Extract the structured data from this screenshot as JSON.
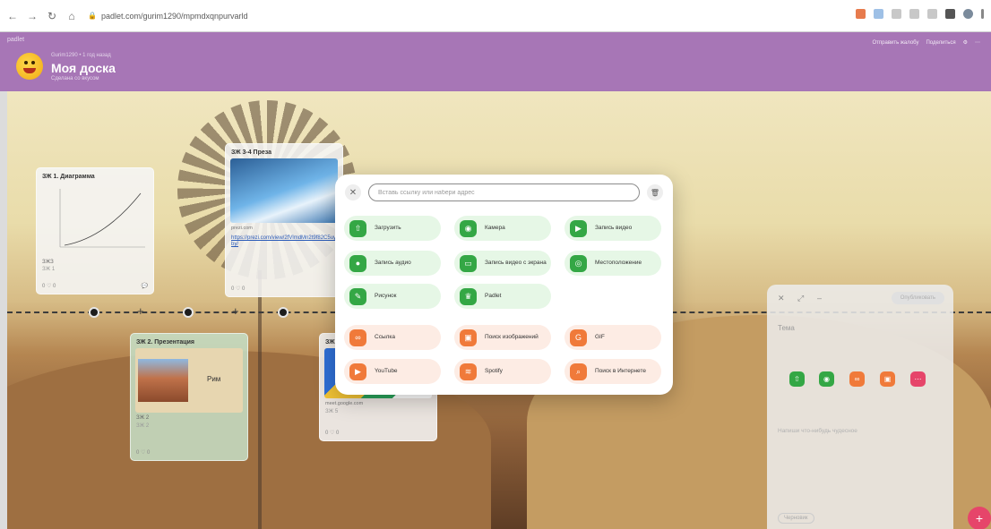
{
  "browser": {
    "url": "padlet.com/gurim1290/mpmdxqnpurvarld"
  },
  "header": {
    "logo": "padlet",
    "author": "Gurim1290 • 1 год назад",
    "title": "Моя доска",
    "subtitle": "Сделана со вкусом",
    "actions": [
      "Отправить жалобу",
      "Поделиться"
    ]
  },
  "cards": [
    {
      "title": "ЗЖ 1. Диаграмма",
      "label": "ЗЖЗ",
      "meta": "ЗЖ 1",
      "reactions": "0 ♡ 0"
    },
    {
      "title": "ЗЖ 3-4 Преза",
      "source": "prezi.com",
      "link": "https://prezi.com/view/2fVlmdMn2t9f82C5uyby/",
      "reactions": "0 ♡ 0"
    },
    {
      "title": "ЗЖ 2. Презентация",
      "slide_text": "Рим",
      "tag": "ЗЖ 2",
      "meta": "ЗЖ 2",
      "reactions": "0 ♡ 0"
    },
    {
      "title": "ЗЖ",
      "source": "meet.google.com",
      "meta": "ЗЖ 5",
      "reactions": "0 ♡ 0"
    }
  ],
  "menu": {
    "search_placeholder": "Вставь ссылку или набери адрес",
    "options": [
      {
        "label": "Загрузить",
        "icon": "upload-icon"
      },
      {
        "label": "Камера",
        "icon": "camera-icon"
      },
      {
        "label": "Запись видео",
        "icon": "video-record-icon"
      },
      {
        "label": "Запись аудио",
        "icon": "microphone-icon"
      },
      {
        "label": "Запись видео с экрана",
        "icon": "screen-record-icon"
      },
      {
        "label": "Местоположение",
        "icon": "location-icon"
      },
      {
        "label": "Рисунок",
        "icon": "pencil-icon"
      },
      {
        "label": "Padlet",
        "icon": "padlet-icon"
      },
      {
        "label": "Ссылка",
        "icon": "link-icon"
      },
      {
        "label": "Поиск изображений",
        "icon": "image-search-icon"
      },
      {
        "label": "GIF",
        "icon": "gif-icon"
      },
      {
        "label": "YouTube",
        "icon": "youtube-icon"
      },
      {
        "label": "Spotify",
        "icon": "spotify-icon"
      },
      {
        "label": "Поиск в Интернете",
        "icon": "web-search-icon"
      }
    ]
  },
  "compose": {
    "publish": "Опубликовать",
    "title_placeholder": "Тема",
    "body_placeholder": "Напиши что-нибудь чудесное",
    "draft": "Черновик"
  },
  "colors": {
    "header": "#a776b6",
    "green": "#34a745",
    "orange": "#f07a3a",
    "fab": "#e6456a"
  }
}
